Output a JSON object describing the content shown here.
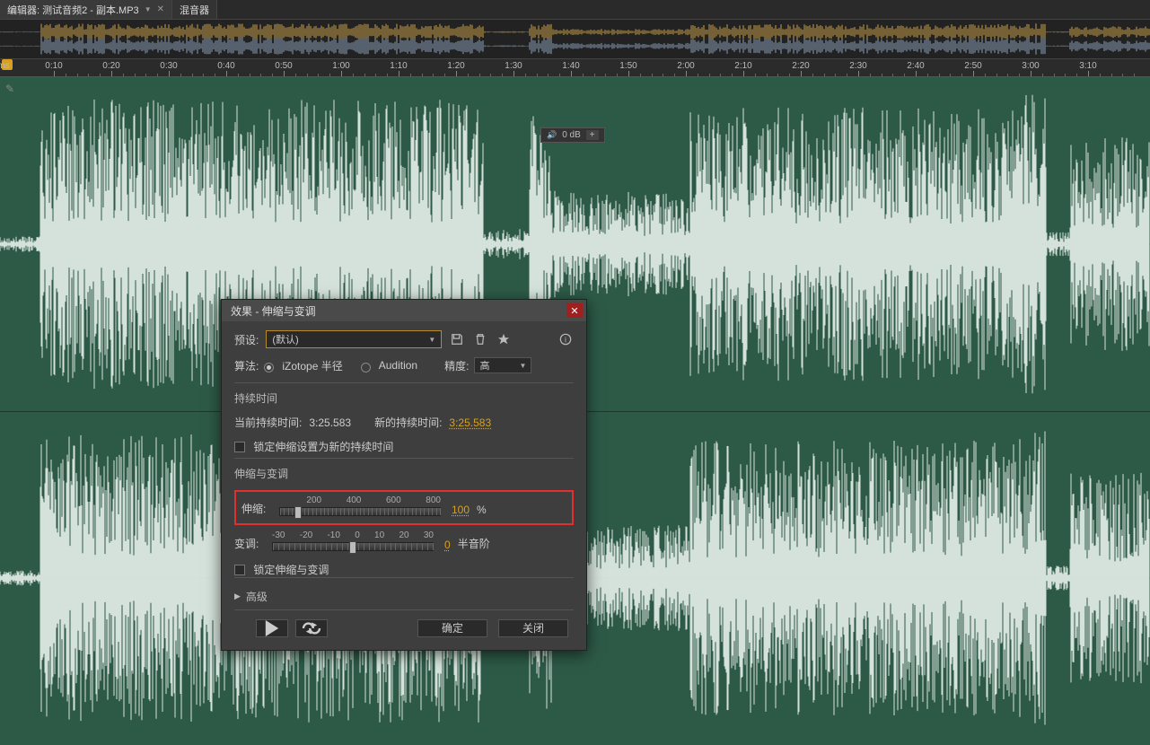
{
  "tabs": {
    "items": [
      {
        "label": "编辑器: 测试音频2 - 副本.MP3",
        "active": true
      },
      {
        "label": "混音器",
        "active": false
      }
    ]
  },
  "ruler": {
    "unit": "ms",
    "labels": [
      "0:10",
      "0:20",
      "0:30",
      "0:40",
      "0:50",
      "1:00",
      "1:10",
      "1:20",
      "1:30",
      "1:40",
      "1:50",
      "2:00",
      "2:10",
      "2:20",
      "2:30",
      "2:40",
      "2:50",
      "3:00",
      "3:10"
    ]
  },
  "db_float": "0 dB",
  "dialog": {
    "title": "效果 - 伸缩与变调",
    "preset_label": "预设:",
    "preset_value": "(默认)",
    "algo_label": "算法:",
    "algo_options": [
      "iZotope 半径",
      "Audition"
    ],
    "precision_label": "精度:",
    "precision_value": "高",
    "duration_group": "持续时间",
    "current_dur_label": "当前持续时间:",
    "current_dur_value": "3:25.583",
    "new_dur_label": "新的持续时间:",
    "new_dur_value": "3:25.583",
    "lock_dur_label": "锁定伸缩设置为新的持续时间",
    "stretch_group": "伸缩与变调",
    "stretch_label": "伸缩:",
    "stretch_scale": [
      "200",
      "400",
      "600",
      "800"
    ],
    "stretch_value": "100",
    "stretch_unit": "%",
    "pitch_label": "变调:",
    "pitch_scale": [
      "-30",
      "-20",
      "-10",
      "0",
      "10",
      "20",
      "30"
    ],
    "pitch_value": "0",
    "pitch_unit": "半音阶",
    "lock_sp_label": "锁定伸缩与变调",
    "advanced_label": "高级",
    "ok": "确定",
    "close": "关闭"
  }
}
